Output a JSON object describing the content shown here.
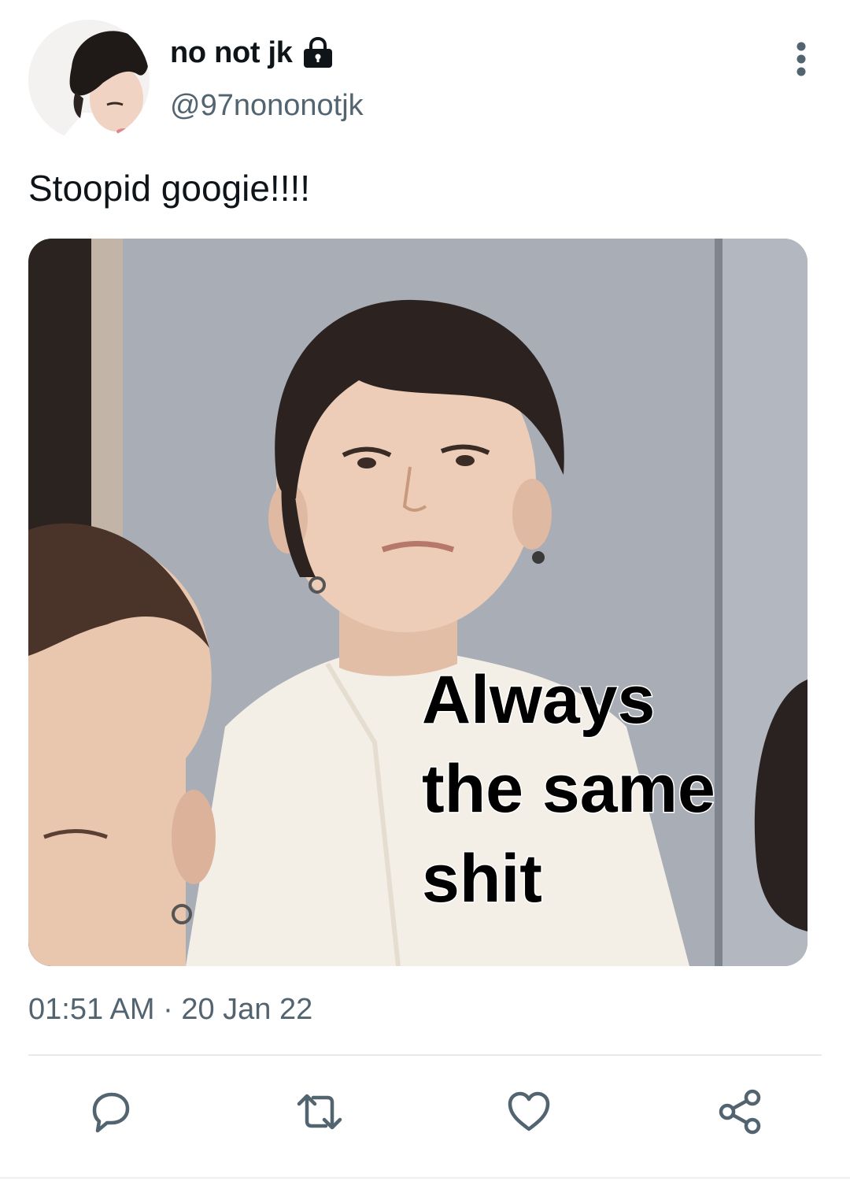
{
  "user": {
    "display_name": "no not jk",
    "handle": "@97nononotjk",
    "protected": true,
    "avatar_icon": "user-avatar-photo"
  },
  "tweet": {
    "text": "Stoopid googie!!!!",
    "timestamp": "01:51 AM · 20 Jan 22"
  },
  "media": {
    "caption_lines": [
      "Always",
      "the same",
      "shit"
    ]
  },
  "actions": [
    {
      "icon": "reply-icon"
    },
    {
      "icon": "retweet-icon"
    },
    {
      "icon": "like-icon"
    },
    {
      "icon": "share-icon"
    }
  ],
  "colors": {
    "text_primary": "#0f1419",
    "text_secondary": "#536471",
    "icon": "#536471",
    "divider": "#e6e9eb"
  }
}
